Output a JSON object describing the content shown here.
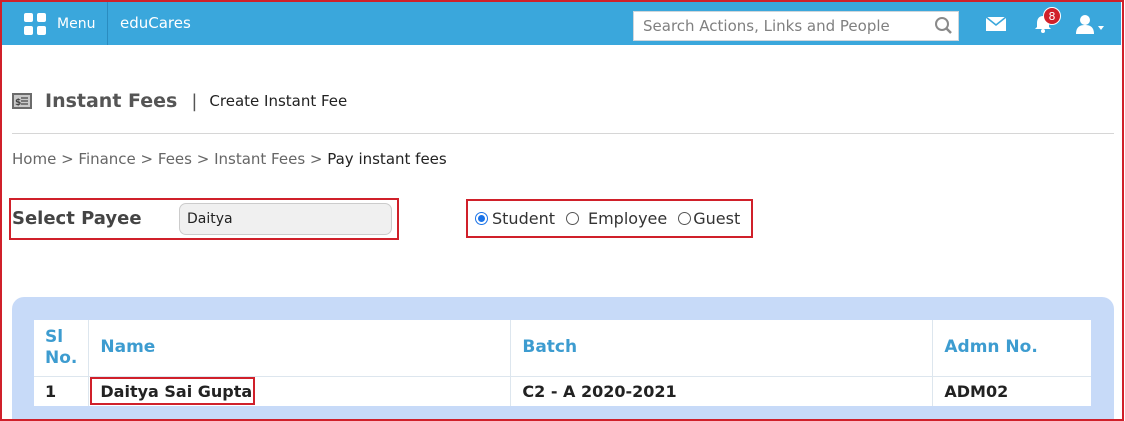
{
  "topbar": {
    "menu_label": "Menu",
    "brand": "eduCares",
    "search_placeholder": "Search Actions, Links and People",
    "notification_count": "8"
  },
  "page": {
    "title": "Instant Fees",
    "separator": "|",
    "subtitle": "Create Instant Fee"
  },
  "breadcrumb": {
    "trail": "Home > Finance > Fees > Instant Fees > ",
    "current": "Pay instant fees"
  },
  "payee": {
    "label": "Select Payee",
    "value": "Daitya"
  },
  "payee_type": {
    "options": [
      "Student",
      "Employee",
      "Guest"
    ],
    "selected": "Student"
  },
  "table": {
    "headers": {
      "sl_line1": "Sl",
      "sl_line2": "No.",
      "name": "Name",
      "batch": "Batch",
      "admn": "Admn No."
    },
    "rows": [
      {
        "sl": "1",
        "name": "Daitya Sai Gupta",
        "batch": "C2 - A 2020-2021",
        "admn": "ADM02"
      }
    ]
  },
  "colors": {
    "topbar": "#3aa7dc",
    "header_text": "#3d9cd0",
    "highlight": "#d0202a",
    "panel": "#c7daf8"
  }
}
